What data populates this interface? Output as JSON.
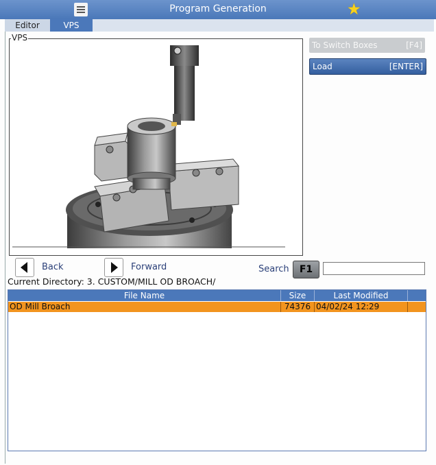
{
  "header": {
    "title": "Program Generation",
    "menu_icon": "hamburger-icon",
    "favorite_icon": "star-icon"
  },
  "tabs": [
    {
      "label": "Editor"
    },
    {
      "label": "VPS"
    }
  ],
  "vps": {
    "legend": "VPS",
    "preview": "mill-od-broach-setup-image"
  },
  "side": {
    "switch_label": "To Switch Boxes",
    "switch_key": "[F4]",
    "load_label": "Load",
    "load_key": "[ENTER]"
  },
  "nav": {
    "back": "Back",
    "forward": "Forward",
    "search_label": "Search",
    "search_key": "F1",
    "search_value": ""
  },
  "current_directory": "Current Directory: 3. CUSTOM/MILL OD BROACH/",
  "table": {
    "headers": [
      "File Name",
      "Size",
      "Last Modified"
    ],
    "rows": [
      {
        "name": "OD Mill Broach",
        "size": "74376",
        "modified": "04/02/24 12:29"
      }
    ]
  },
  "colors": {
    "accent": "#4b78ba",
    "selected_row": "#f2941e",
    "star": "#f8d21c"
  }
}
